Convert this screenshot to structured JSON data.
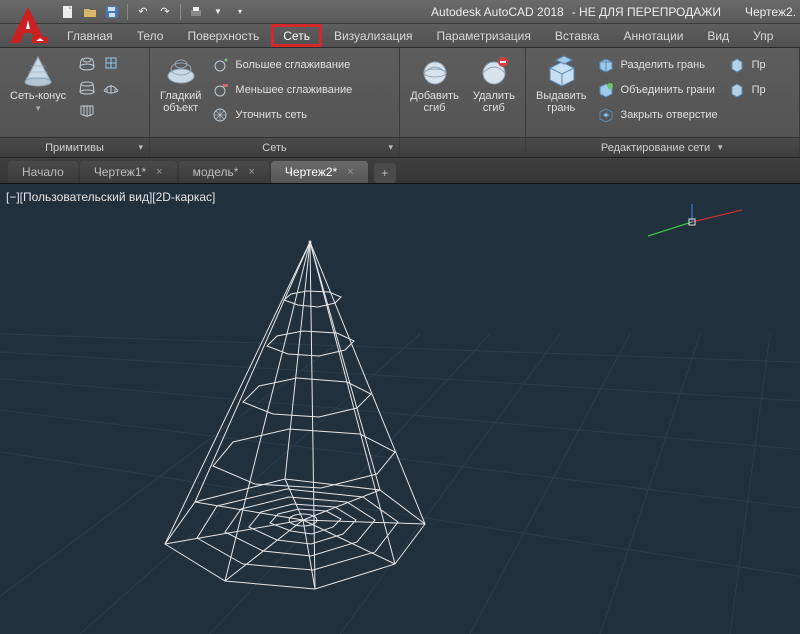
{
  "title": {
    "app": "Autodesk AutoCAD 2018",
    "suffix": "- НЕ ДЛЯ ПЕРЕПРОДАЖИ",
    "doc": "Чертеж2."
  },
  "menu": {
    "items": [
      {
        "label": "Главная"
      },
      {
        "label": "Тело"
      },
      {
        "label": "Поверхность"
      },
      {
        "label": "Сеть",
        "highlighted": true
      },
      {
        "label": "Визуализация"
      },
      {
        "label": "Параметризация"
      },
      {
        "label": "Вставка"
      },
      {
        "label": "Аннотации"
      },
      {
        "label": "Вид"
      },
      {
        "label": "Упр"
      }
    ]
  },
  "ribbon": {
    "primitives": {
      "title": "Примитивы",
      "main_btn": "Сеть-конус"
    },
    "smooth_obj": "Гладкий\nобъект",
    "mesh_panel": {
      "title": "Сеть",
      "items": [
        "Большее сглаживание",
        "Меньшее сглаживание",
        "Уточнить сеть"
      ]
    },
    "crease": {
      "add": "Добавить\nсгиб",
      "remove": "Удалить\nсгиб"
    },
    "extrude": {
      "btn": "Выдавить\nгрань",
      "title": "Редактирование сети"
    },
    "edit_items": [
      "Разделить грань",
      "Объединить грани",
      "Закрыть отверстие"
    ],
    "right_bits": [
      "Пр",
      "Пр"
    ]
  },
  "doc_tabs": {
    "items": [
      {
        "label": "Начало",
        "active": false
      },
      {
        "label": "Чертеж1*",
        "active": false
      },
      {
        "label": "модель*",
        "active": false
      },
      {
        "label": "Чертеж2*",
        "active": true
      }
    ]
  },
  "viewport": {
    "label": "[−][Пользовательский вид][2D-каркас]"
  }
}
